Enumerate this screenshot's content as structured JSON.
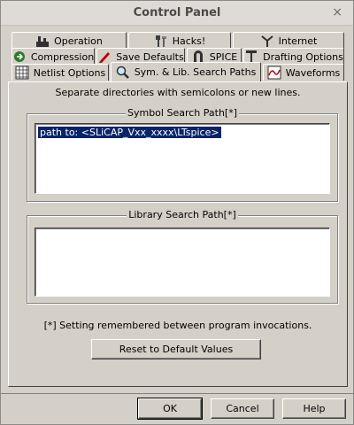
{
  "window": {
    "title": "Control Panel",
    "close_glyph": "×"
  },
  "tabs_row1": [
    {
      "label": "Operation",
      "icon": "hammer-icon"
    },
    {
      "label": "Hacks!",
      "icon": "hacks-icon"
    },
    {
      "label": "Internet",
      "icon": "antenna-icon"
    }
  ],
  "tabs_row2": [
    {
      "label": "Compression",
      "icon": "compression-icon"
    },
    {
      "label": "Save Defaults",
      "icon": "pencil-icon"
    },
    {
      "label": "SPICE",
      "icon": "magnet-icon"
    },
    {
      "label": "Drafting Options",
      "icon": "drafting-icon"
    }
  ],
  "tabs_row3": [
    {
      "label": "Netlist Options",
      "icon": "grid-icon"
    },
    {
      "label": "Sym. & Lib. Search Paths",
      "icon": "magnifier-icon",
      "active": true
    },
    {
      "label": "Waveforms",
      "icon": "waveform-icon"
    }
  ],
  "panel": {
    "hint": "Separate directories with semicolons or new lines.",
    "symbol_group_label": "Symbol Search Path[*]",
    "symbol_path_value": "path to:  <SLiCAP_Vxx_xxxx\\LTspice>",
    "library_group_label": "Library Search Path[*]",
    "library_path_value": "",
    "note": "[*] Setting remembered between program invocations.",
    "reset_label": "Reset to Default Values"
  },
  "footer": {
    "ok_label": "OK",
    "cancel_label": "Cancel",
    "help_label": "Help"
  },
  "colors": {
    "face": "#d4d0c8",
    "selection": "#0a246a"
  }
}
